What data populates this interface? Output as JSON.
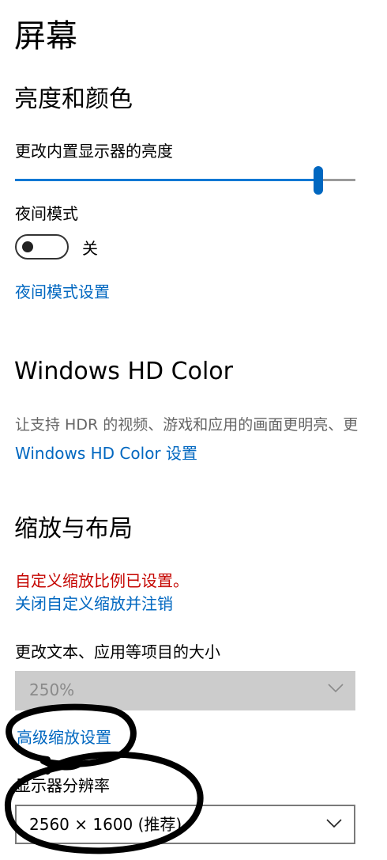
{
  "page": {
    "title": "屏幕"
  },
  "brightness_color": {
    "heading": "亮度和颜色",
    "slider_label": "更改内置显示器的亮度",
    "brightness_level": 0.89,
    "night_light_label": "夜间模式",
    "night_light_state": "关",
    "night_light_settings_link": "夜间模式设置"
  },
  "hd_color": {
    "heading": "Windows HD Color",
    "description": "让支持 HDR 的视频、游戏和应用的画面更明亮、更",
    "settings_link": "Windows HD Color 设置"
  },
  "scale_layout": {
    "heading": "缩放与布局",
    "custom_scale_warning": "自定义缩放比例已设置。",
    "turn_off_link": "关闭自定义缩放并注销",
    "scale_label": "更改文本、应用等项目的大小",
    "scale_value": "250%",
    "advanced_link": "高级缩放设置",
    "resolution_label": "显示器分辨率",
    "resolution_value": "2560 × 1600 (推荐)"
  },
  "colors": {
    "accent": "#0067c0",
    "warning": "#c50500",
    "disabled_bg": "#cccccc"
  }
}
